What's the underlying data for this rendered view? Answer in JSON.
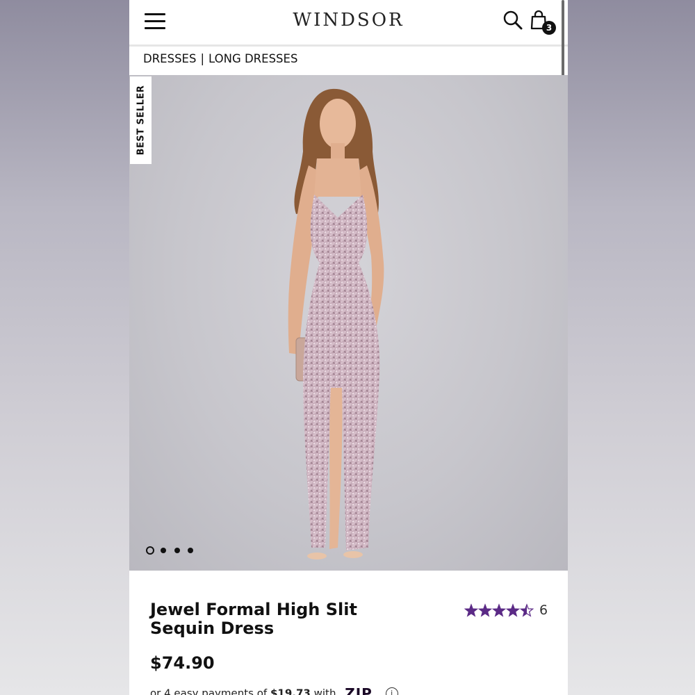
{
  "header": {
    "logo": "WINDSOR",
    "cart_count": "3"
  },
  "breadcrumb": {
    "items": [
      "DRESSES",
      "LONG DRESSES"
    ],
    "separator": "|"
  },
  "hero": {
    "badge": "BEST SELLER",
    "carousel": {
      "count": 4,
      "active_index": 0
    }
  },
  "product": {
    "title": "Jewel Formal High Slit Sequin Dress",
    "rating": 4.5,
    "review_count": "6",
    "price": "$74.90",
    "payment_prefix": "or 4 easy payments of",
    "payment_amount": "$19.73",
    "payment_suffix": "with",
    "payment_provider": "ZIP"
  },
  "colors": {
    "star": "#5b2a86",
    "dress": "#c9a8b8",
    "text": "#111111"
  },
  "icons": [
    "hamburger-menu-icon",
    "search-icon",
    "shopping-bag-icon",
    "star-icon",
    "info-icon"
  ]
}
